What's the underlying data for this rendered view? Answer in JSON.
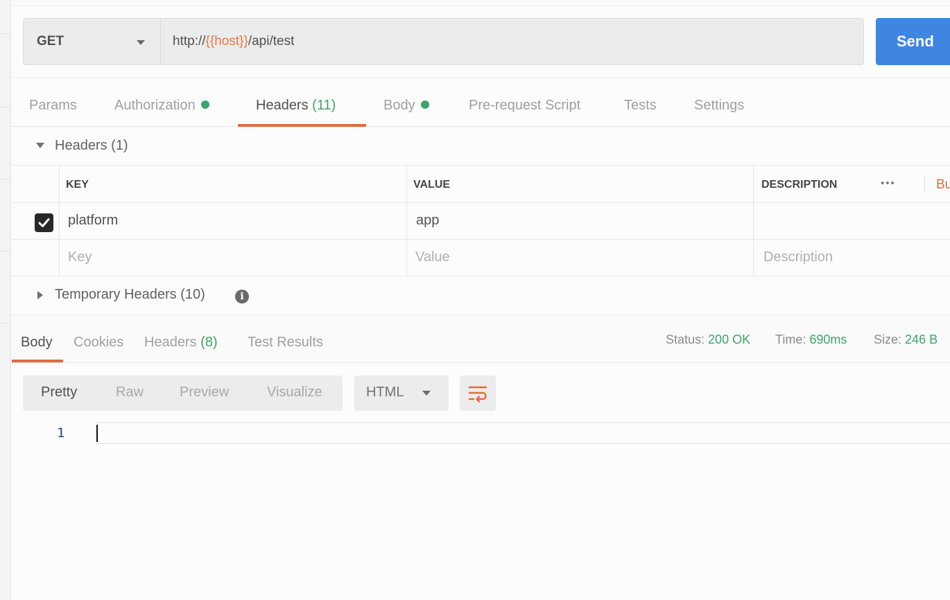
{
  "request": {
    "method": "GET",
    "url_prefix": "http://",
    "url_variable": "{{host}}",
    "url_suffix": "/api/test",
    "send_label": "Send"
  },
  "request_tabs": [
    {
      "label": "Params",
      "count": "",
      "dot": false,
      "active": false
    },
    {
      "label": "Authorization",
      "count": "",
      "dot": true,
      "active": false
    },
    {
      "label": "Headers",
      "count": "(11)",
      "dot": false,
      "active": true
    },
    {
      "label": "Body",
      "count": "",
      "dot": true,
      "active": false
    },
    {
      "label": "Pre-request Script",
      "count": "",
      "dot": false,
      "active": false
    },
    {
      "label": "Tests",
      "count": "",
      "dot": false,
      "active": false
    },
    {
      "label": "Settings",
      "count": "",
      "dot": false,
      "active": false
    }
  ],
  "headers_section": {
    "title": "Headers (1)",
    "columns": {
      "key": "KEY",
      "value": "VALUE",
      "description": "DESCRIPTION"
    },
    "more_label": "•••",
    "bulk_edit_label": "Bu",
    "rows": [
      {
        "checked": true,
        "key": "platform",
        "value": "app",
        "description": ""
      }
    ],
    "placeholders": {
      "key": "Key",
      "value": "Value",
      "description": "Description"
    }
  },
  "temporary_headers": {
    "title": "Temporary Headers (10)",
    "info_icon": "i"
  },
  "response_tabs": [
    {
      "label": "Body",
      "count": "",
      "active": true
    },
    {
      "label": "Cookies",
      "count": "",
      "active": false
    },
    {
      "label": "Headers",
      "count": "(8)",
      "active": false
    },
    {
      "label": "Test Results",
      "count": "",
      "active": false
    }
  ],
  "response_status": {
    "status_label": "Status:",
    "status_value": "200 OK",
    "time_label": "Time:",
    "time_value": "690ms",
    "size_label": "Size:",
    "size_value": "246 B"
  },
  "view_modes": [
    "Pretty",
    "Raw",
    "Preview",
    "Visualize"
  ],
  "active_view_mode": "Pretty",
  "format": "HTML",
  "editor": {
    "line_number": "1"
  },
  "colors": {
    "accent": "#e06a3d",
    "send": "#3f86e2",
    "success": "#3ba56b",
    "variable": "#e97a45"
  },
  "icons": {
    "wrap": "wrap-lines-icon",
    "info": "info-icon",
    "checkbox": "checkmark-icon"
  }
}
